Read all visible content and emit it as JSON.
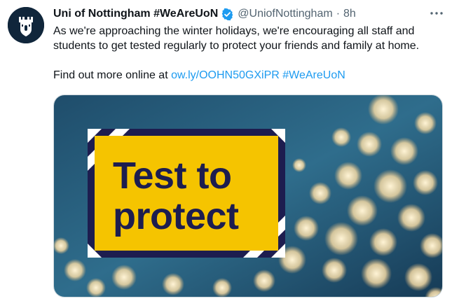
{
  "tweet": {
    "author_name": "Uni of Nottingham #WeAreUoN",
    "handle": "@UniofNottingham",
    "separator": "·",
    "time": "8h",
    "more_glyph": "···",
    "body_line1": "As we're approaching the winter holidays, we're encouraging all staff and students to get tested regularly to protect your friends and family at home.",
    "body_prefix": "Find out more online at ",
    "link_text": "ow.ly/OOHN50GXiPR",
    "hashtag_text": "#WeAreUoN"
  },
  "media": {
    "sign_line1": "Test to",
    "sign_line2": "protect"
  },
  "icons": {
    "avatar": "university-crest-icon",
    "verified": "verified-badge-icon",
    "more": "more-options-icon"
  },
  "colors": {
    "link": "#1d9bf0",
    "verified": "#1d9bf0",
    "sign_yellow": "#f5c400",
    "sign_text": "#1d1d4f",
    "avatar_bg": "#10263b"
  }
}
